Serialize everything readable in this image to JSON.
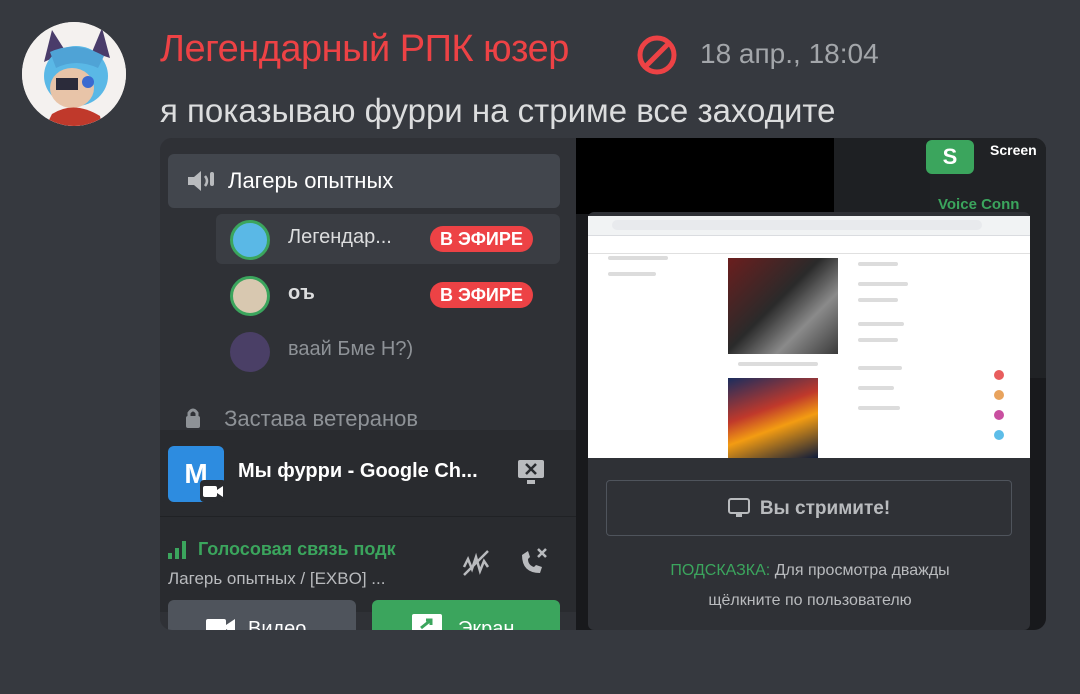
{
  "message": {
    "username": "Легендарный РПК юзер",
    "timestamp": "18 апр., 18:04",
    "text": "я показываю фурри на стриме все заходите",
    "colors": {
      "username": "#ed4245",
      "background": "#36393f"
    }
  },
  "screenshot": {
    "voice_channel": "Лагерь опытных",
    "members": [
      {
        "name": "Легендар...",
        "badge": "В ЭФИРЕ"
      },
      {
        "name": "оъ",
        "badge": "В ЭФИРЕ"
      },
      {
        "name": "ваай Бме Н?)"
      }
    ],
    "category": "Застава ветеранов",
    "stream_tile_letter": "М",
    "stream_title": "Мы фурри - Google Ch...",
    "voice_status": "Голосовая связь подк",
    "voice_location": "Лагерь опытных / [EXBO] ...",
    "video_button": "Видео",
    "screen_button": "Экран",
    "screen_label": "Screen",
    "voice_connected_label": "Voice Conn",
    "streaming_label": "Вы стримите!",
    "hint_prefix": "ПОДСКАЗКА:",
    "hint_line1": "Для просмотра дважды",
    "hint_line2": "щёлкните по пользователю",
    "colors": {
      "live": "#ed4245",
      "green": "#3ba55d",
      "panel": "#2f3136"
    }
  }
}
